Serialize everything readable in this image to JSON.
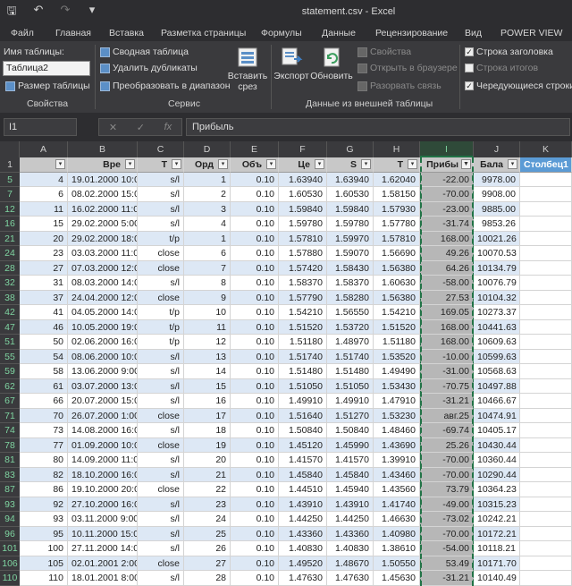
{
  "window": {
    "title": "statement.csv - Excel"
  },
  "menu": [
    "Файл",
    "Главная",
    "Вставка",
    "Разметка страницы",
    "Формулы",
    "Данные",
    "Рецензирование",
    "Вид",
    "POWER VIEW"
  ],
  "ribbon": {
    "table_name_label": "Имя таблицы:",
    "table_name_value": "Таблица2",
    "resize_table": "Размер таблицы",
    "group_properties": "Свойства",
    "pivot": "Сводная таблица",
    "remove_duplicates": "Удалить дубликаты",
    "convert_range": "Преобразовать в диапазон",
    "group_tools": "Сервис",
    "insert_slicer_1": "Вставить",
    "insert_slicer_2": "срез",
    "export": "Экспорт",
    "refresh": "Обновить",
    "properties": "Свойства",
    "open_browser": "Открыть в браузере",
    "unlink": "Разорвать связь",
    "group_external": "Данные из внешней таблицы",
    "header_row": "Строка заголовка",
    "total_row": "Строка итогов",
    "banded_rows": "Чередующиеся строки"
  },
  "formula_bar": {
    "name_box": "I1",
    "fx": "fx",
    "content": "Прибыль"
  },
  "columns": [
    "A",
    "B",
    "C",
    "D",
    "E",
    "F",
    "G",
    "H",
    "I",
    "J",
    "K"
  ],
  "headers": [
    "",
    "Вре",
    "T",
    "Орд",
    "Объ",
    "Це",
    "S",
    "T",
    "Прибы",
    "Бала",
    "Столбец1"
  ],
  "rows": [
    [
      "5",
      "4",
      "19.01.2000 10:00",
      "s/l",
      "1",
      "0.10",
      "1.63940",
      "1.63940",
      "1.62040",
      "-22.00",
      "9978.00"
    ],
    [
      "7",
      "6",
      "08.02.2000 15:00",
      "s/l",
      "2",
      "0.10",
      "1.60530",
      "1.60530",
      "1.58150",
      "-70.00",
      "9908.00"
    ],
    [
      "12",
      "11",
      "16.02.2000 11:00",
      "s/l",
      "3",
      "0.10",
      "1.59840",
      "1.59840",
      "1.57930",
      "-23.00",
      "9885.00"
    ],
    [
      "16",
      "15",
      "29.02.2000 5:00",
      "s/l",
      "4",
      "0.10",
      "1.59780",
      "1.59780",
      "1.57780",
      "-31.74",
      "9853.26"
    ],
    [
      "21",
      "20",
      "29.02.2000 18:00",
      "t/p",
      "1",
      "0.10",
      "1.57810",
      "1.59970",
      "1.57810",
      "168.00",
      "10021.26"
    ],
    [
      "24",
      "23",
      "03.03.2000 11:00",
      "close",
      "6",
      "0.10",
      "1.57880",
      "1.59070",
      "1.56690",
      "49.26",
      "10070.53"
    ],
    [
      "28",
      "27",
      "07.03.2000 12:00",
      "close",
      "7",
      "0.10",
      "1.57420",
      "1.58430",
      "1.56380",
      "64.26",
      "10134.79"
    ],
    [
      "32",
      "31",
      "08.03.2000 14:00",
      "s/l",
      "8",
      "0.10",
      "1.58370",
      "1.58370",
      "1.60630",
      "-58.00",
      "10076.79"
    ],
    [
      "38",
      "37",
      "24.04.2000 12:00",
      "close",
      "9",
      "0.10",
      "1.57790",
      "1.58280",
      "1.56380",
      "27.53",
      "10104.32"
    ],
    [
      "42",
      "41",
      "04.05.2000 14:00",
      "t/p",
      "10",
      "0.10",
      "1.54210",
      "1.56550",
      "1.54210",
      "169.05",
      "10273.37"
    ],
    [
      "47",
      "46",
      "10.05.2000 19:00",
      "t/p",
      "11",
      "0.10",
      "1.51520",
      "1.53720",
      "1.51520",
      "168.00",
      "10441.63"
    ],
    [
      "51",
      "50",
      "02.06.2000 16:00",
      "t/p",
      "12",
      "0.10",
      "1.51180",
      "1.48970",
      "1.51180",
      "168.00",
      "10609.63"
    ],
    [
      "55",
      "54",
      "08.06.2000 10:00",
      "s/l",
      "13",
      "0.10",
      "1.51740",
      "1.51740",
      "1.53520",
      "-10.00",
      "10599.63"
    ],
    [
      "59",
      "58",
      "13.06.2000 9:00",
      "s/l",
      "14",
      "0.10",
      "1.51480",
      "1.51480",
      "1.49490",
      "-31.00",
      "10568.63"
    ],
    [
      "62",
      "61",
      "03.07.2000 13:00",
      "s/l",
      "15",
      "0.10",
      "1.51050",
      "1.51050",
      "1.53430",
      "-70.75",
      "10497.88"
    ],
    [
      "67",
      "66",
      "20.07.2000 15:00",
      "s/l",
      "16",
      "0.10",
      "1.49910",
      "1.49910",
      "1.47910",
      "-31.21",
      "10466.67"
    ],
    [
      "71",
      "70",
      "26.07.2000 1:00",
      "close",
      "17",
      "0.10",
      "1.51640",
      "1.51270",
      "1.53230",
      "авг.25",
      "10474.91"
    ],
    [
      "74",
      "73",
      "14.08.2000 16:00",
      "s/l",
      "18",
      "0.10",
      "1.50840",
      "1.50840",
      "1.48460",
      "-69.74",
      "10405.17"
    ],
    [
      "78",
      "77",
      "01.09.2000 10:00",
      "close",
      "19",
      "0.10",
      "1.45120",
      "1.45990",
      "1.43690",
      "25.26",
      "10430.44"
    ],
    [
      "81",
      "80",
      "14.09.2000 11:00",
      "s/l",
      "20",
      "0.10",
      "1.41570",
      "1.41570",
      "1.39910",
      "-70.00",
      "10360.44"
    ],
    [
      "83",
      "82",
      "18.10.2000 16:00",
      "s/l",
      "21",
      "0.10",
      "1.45840",
      "1.45840",
      "1.43460",
      "-70.00",
      "10290.44"
    ],
    [
      "87",
      "86",
      "19.10.2000 20:00",
      "close",
      "22",
      "0.10",
      "1.44510",
      "1.45940",
      "1.43560",
      "73.79",
      "10364.23"
    ],
    [
      "93",
      "92",
      "27.10.2000 16:00",
      "s/l",
      "23",
      "0.10",
      "1.43910",
      "1.43910",
      "1.41740",
      "-49.00",
      "10315.23"
    ],
    [
      "94",
      "93",
      "03.11.2000 9:00",
      "s/l",
      "24",
      "0.10",
      "1.44250",
      "1.44250",
      "1.46630",
      "-73.02",
      "10242.21"
    ],
    [
      "96",
      "95",
      "10.11.2000 15:00",
      "s/l",
      "25",
      "0.10",
      "1.43360",
      "1.43360",
      "1.40980",
      "-70.00",
      "10172.21"
    ],
    [
      "101",
      "100",
      "27.11.2000 14:00",
      "s/l",
      "26",
      "0.10",
      "1.40830",
      "1.40830",
      "1.38610",
      "-54.00",
      "10118.21"
    ],
    [
      "106",
      "105",
      "02.01.2001 2:00",
      "close",
      "27",
      "0.10",
      "1.49520",
      "1.48670",
      "1.50550",
      "53.49",
      "10171.70"
    ],
    [
      "110",
      "110",
      "18.01.2001 8:00",
      "s/l",
      "28",
      "0.10",
      "1.47630",
      "1.47630",
      "1.45630",
      "-31.21",
      "10140.49"
    ]
  ]
}
